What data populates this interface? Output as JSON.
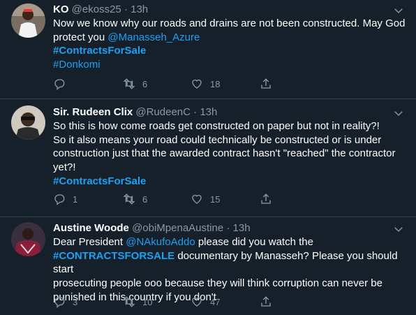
{
  "tweets": [
    {
      "name": "KO",
      "handle": "@ekoss25",
      "sep": " · ",
      "time": "13h",
      "line1": "Now we know why our roads and drains are not been constructed. May God",
      "line2_text": "protect you ",
      "line2_mention": "@Manasseh_Azure",
      "hashtag1": "#ContractsForSale",
      "hashtag2": "#Donkomi",
      "retweets": "6",
      "likes": "18"
    },
    {
      "name": "Sir. Rudeen Clix",
      "handle": "@RudeenC",
      "sep": " · ",
      "time": "13h",
      "line1": "So this is how come roads get constructed on paper but not in reality?!",
      "line2": "So it also means your road could technically be constructed or is under",
      "line3": "construction just that the awarded contract hasn't \"reached\" the contractor",
      "line4": "yet?!",
      "hashtag": "#ContractsForSale",
      "replies": "1",
      "retweets": "6",
      "likes": "15"
    },
    {
      "name": "Austine Woode",
      "handle": "@obiMpenaAustine",
      "sep": " · ",
      "time": "13h",
      "line1_text": "Dear President ",
      "line1_mention": "@NAkufoAddo",
      "line1_rest": " please did you watch the",
      "line2_hashtag": "#CONTRACTSFORSALE",
      "line2_rest": " documentary by Manasseh? Please you should start",
      "line3": "prosecuting people ooo because they will think corruption can never be",
      "line4": "punished in this country if you don't",
      "replies": "3",
      "retweets": "10",
      "likes": "47"
    }
  ],
  "icons": {
    "reply": "reply-icon",
    "retweet": "retweet-icon",
    "like": "heart-icon",
    "share": "share-icon",
    "caret": "chevron-down-icon"
  },
  "colors": {
    "background": "#15202b",
    "divider": "#38444d",
    "secondary_text": "#8899a6",
    "accent": "#1da1f2"
  }
}
